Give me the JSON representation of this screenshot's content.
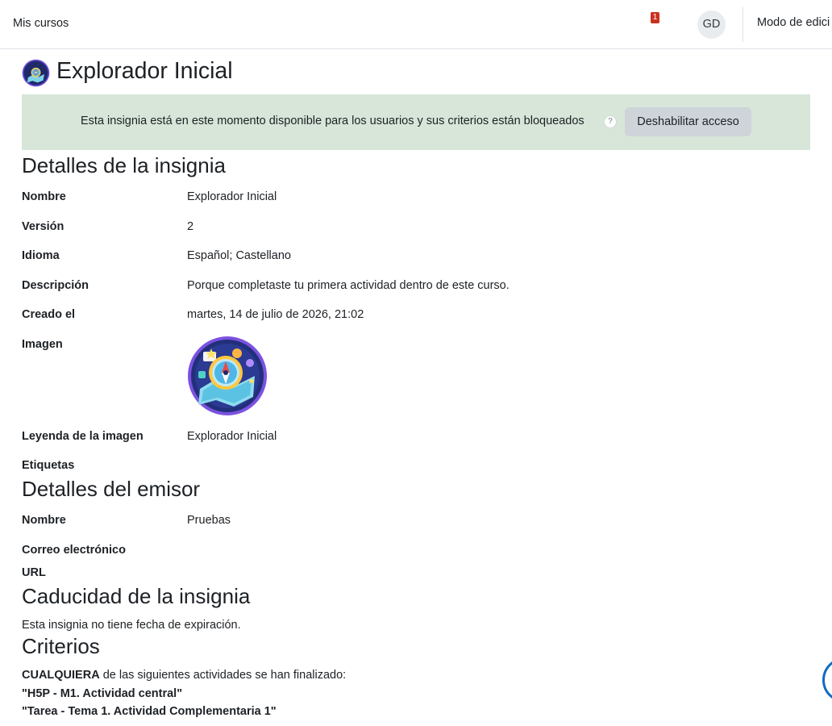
{
  "navbar": {
    "my_courses": "Mis cursos",
    "notification_count": "1",
    "user_initials": "GD",
    "edit_mode": "Modo de edici"
  },
  "header": {
    "title": "Explorador Inicial"
  },
  "alert": {
    "text": "Esta insignia está en este momento disponible para los usuarios y sus criterios están bloqueados",
    "help_glyph": "?",
    "button": "Deshabilitar acceso"
  },
  "badge_details": {
    "heading": "Detalles de la insignia",
    "rows": [
      {
        "label": "Nombre",
        "value": "Explorador Inicial"
      },
      {
        "label": "Versión",
        "value": "2"
      },
      {
        "label": "Idioma",
        "value": "Español; Castellano"
      },
      {
        "label": "Descripción",
        "value": "Porque completaste tu primera actividad dentro de este curso."
      },
      {
        "label": "Creado el",
        "value": "martes, 14 de julio de 2026, 21:02"
      },
      {
        "label": "Imagen",
        "value": ""
      },
      {
        "label": "Leyenda de la imagen",
        "value": "Explorador Inicial"
      },
      {
        "label": "Etiquetas",
        "value": ""
      }
    ]
  },
  "issuer_details": {
    "heading": "Detalles del emisor",
    "rows": [
      {
        "label": "Nombre",
        "value": "Pruebas"
      },
      {
        "label": "Correo electrónico",
        "value": ""
      },
      {
        "label": "URL",
        "value": ""
      }
    ]
  },
  "expiry": {
    "heading": "Caducidad de la insignia",
    "text": "Esta insignia no tiene fecha de expiración."
  },
  "criteria": {
    "heading": "Criterios",
    "keyword": "CUALQUIERA",
    "intro": " de las siguientes actividades se han finalizado:",
    "activities": [
      "\"H5P - M1. Actividad central\"",
      "\"Tarea - Tema 1. Actividad Complementaria 1\""
    ]
  },
  "colors": {
    "alert_bg": "#d7e6d9",
    "notification_badge": "#ca3120",
    "button_bg": "#ced4da",
    "primary": "#0f6cbf"
  },
  "icons": {
    "notifications": "bell-icon",
    "help": "question-circle-icon",
    "badge": "compass-badge-icon"
  }
}
